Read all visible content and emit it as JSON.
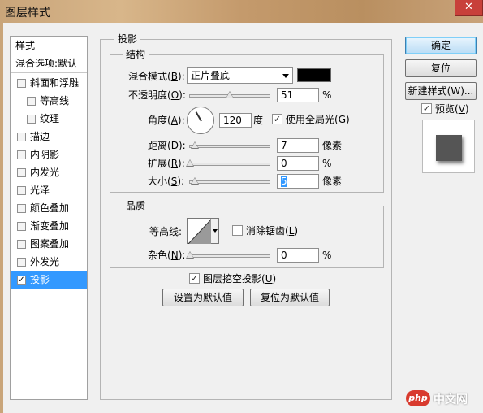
{
  "window": {
    "title": "图层样式",
    "close_glyph": "✕"
  },
  "sidebar": {
    "items": [
      {
        "label": "样式",
        "type": "head"
      },
      {
        "label": "混合选项:默认",
        "type": "head"
      },
      {
        "label": "斜面和浮雕",
        "checked": false
      },
      {
        "label": "等高线",
        "checked": false
      },
      {
        "label": "纹理",
        "checked": false
      },
      {
        "label": "描边",
        "checked": false
      },
      {
        "label": "内阴影",
        "checked": false
      },
      {
        "label": "内发光",
        "checked": false
      },
      {
        "label": "光泽",
        "checked": false
      },
      {
        "label": "颜色叠加",
        "checked": false
      },
      {
        "label": "渐变叠加",
        "checked": false
      },
      {
        "label": "图案叠加",
        "checked": false
      },
      {
        "label": "外发光",
        "checked": false
      },
      {
        "label": "投影",
        "checked": true,
        "selected": true
      }
    ]
  },
  "panel": {
    "title": "投影",
    "structure": {
      "title": "结构",
      "blend_mode": {
        "label": "混合模式",
        "key": "B",
        "value": "正片叠底",
        "color": "#000000"
      },
      "opacity": {
        "label": "不透明度",
        "key": "O",
        "value": "51",
        "unit": "%"
      },
      "angle": {
        "label": "角度",
        "key": "A",
        "value": "120",
        "unit": "度"
      },
      "global_light": {
        "label": "使用全局光",
        "key": "G",
        "checked": true
      },
      "distance": {
        "label": "距离",
        "key": "D",
        "value": "7",
        "unit": "像素"
      },
      "spread": {
        "label": "扩展",
        "key": "R",
        "value": "0",
        "unit": "%"
      },
      "size": {
        "label": "大小",
        "key": "S",
        "value": "5",
        "unit": "像素"
      }
    },
    "quality": {
      "title": "品质",
      "contour": {
        "label": "等高线"
      },
      "anti_alias": {
        "label": "消除锯齿",
        "key": "L",
        "checked": false
      },
      "noise": {
        "label": "杂色",
        "key": "N",
        "value": "0",
        "unit": "%"
      }
    },
    "knockout": {
      "label": "图层挖空投影",
      "key": "U",
      "checked": true
    },
    "set_default": "设置为默认值",
    "reset_default": "复位为默认值"
  },
  "buttons": {
    "ok": "确定",
    "reset": "复位",
    "new_style": "新建样式(W)...",
    "preview_label": "预览",
    "preview_key": "V",
    "preview_checked": true
  },
  "watermark": {
    "logo": "php",
    "site": "中文网"
  }
}
